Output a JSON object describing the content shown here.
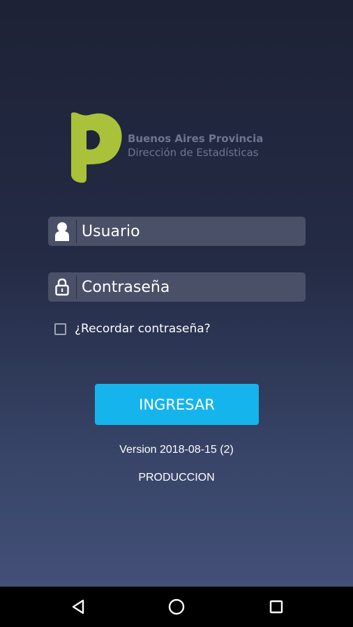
{
  "logo": {
    "line1": "Buenos Aires Provincia",
    "line2": "Dirección de Estadísticas",
    "mark_color": "#a9c23a",
    "text_color": "#6d7591"
  },
  "form": {
    "username_placeholder": "Usuario",
    "password_placeholder": "Contraseña",
    "username_icon": "user-icon",
    "password_icon": "lock-icon",
    "remember_label": "¿Recordar contraseña?",
    "remember_checked": false
  },
  "login_button": {
    "label": "INGRESAR",
    "color": "#16b4ec"
  },
  "footer": {
    "version": "Version 2018-08-15 (2)",
    "environment": "PRODUCCION"
  },
  "navbar": {
    "back_icon": "back-triangle-icon",
    "home_icon": "home-circle-icon",
    "recents_icon": "recents-square-icon"
  }
}
